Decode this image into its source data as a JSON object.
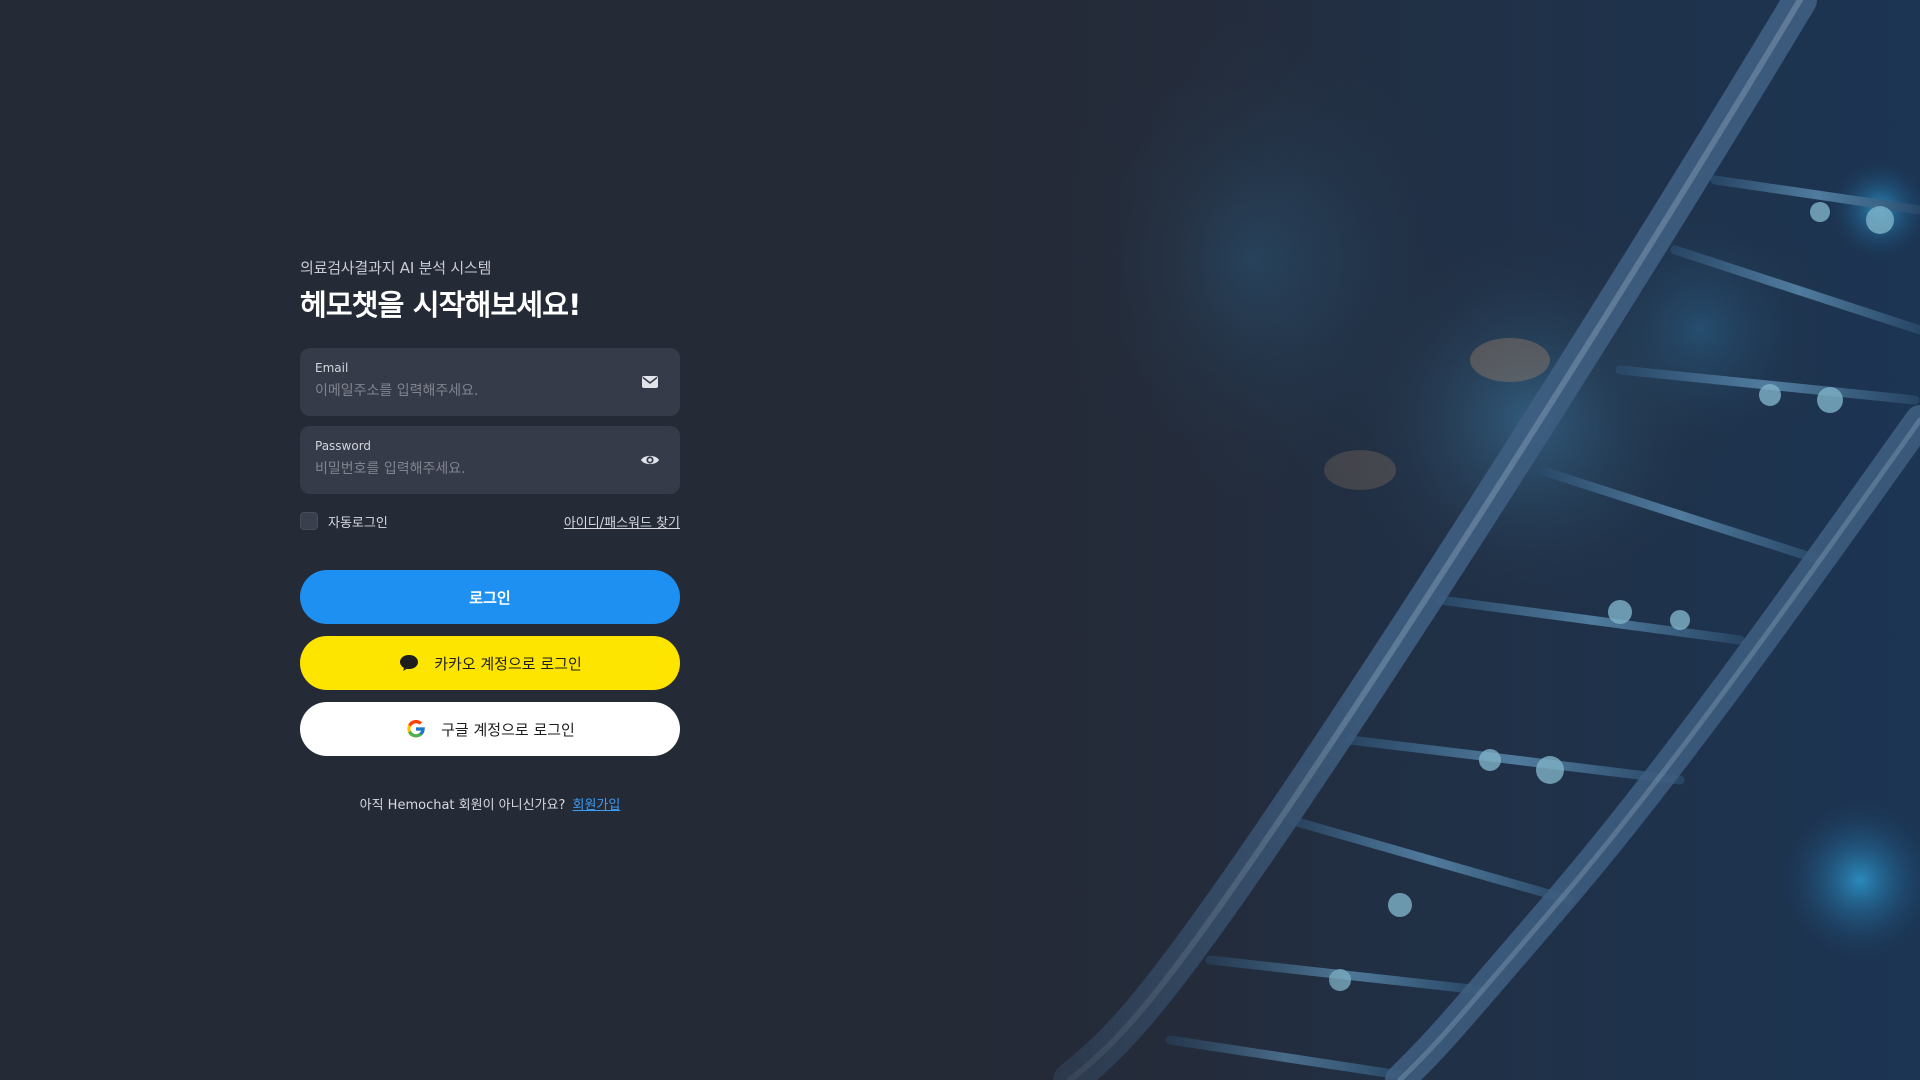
{
  "header": {
    "subtitle": "의료검사결과지 AI 분석 시스템",
    "title": "헤모챗을 시작해보세요!"
  },
  "form": {
    "email": {
      "label": "Email",
      "placeholder": "이메일주소를 입력해주세요.",
      "value": "",
      "icon": "mail-icon"
    },
    "password": {
      "label": "Password",
      "placeholder": "비밀번호를 입력해주세요.",
      "value": "",
      "icon": "eye-icon"
    },
    "remember_label": "자동로그인",
    "remember_checked": false,
    "find_account_link": "아이디/패스워드 찾기"
  },
  "buttons": {
    "login_label": "로그인",
    "kakao_label": "카카오 계정으로 로그인",
    "kakao_icon": "speech-bubble-icon",
    "google_label": "구글 계정으로 로그인",
    "google_icon": "google-logo-icon"
  },
  "signup": {
    "prompt": "아직 Hemochat 회원이 아니신가요?",
    "link": "회원가입"
  },
  "colors": {
    "background": "#252a37",
    "field_bg": "#363b4a",
    "login_button": "#1e90f1",
    "kakao_button": "#fee500",
    "google_button": "#ffffff",
    "link_accent": "#3b9cf5"
  }
}
